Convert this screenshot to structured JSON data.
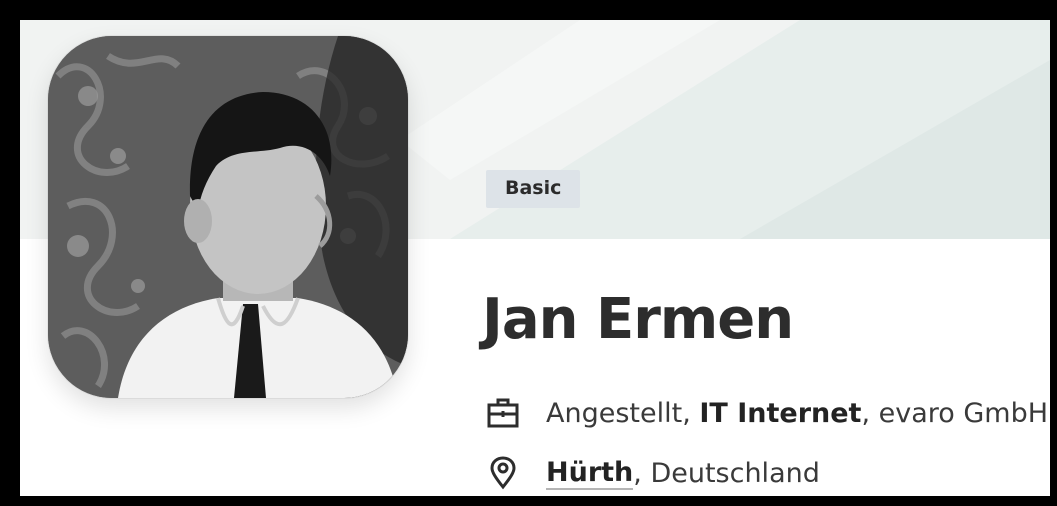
{
  "profile": {
    "badge": "Basic",
    "name": "Jan Ermen",
    "job": {
      "status": "Angestellt",
      "sep1": ", ",
      "industry": "IT Internet",
      "sep2": ", ",
      "company": "evaro GmbH"
    },
    "location": {
      "city": "Hürth",
      "sep": ", ",
      "country": "Deutschland"
    }
  },
  "icons": {
    "job": "briefcase-icon",
    "location": "location-pin-icon"
  },
  "colors": {
    "banner": "#f1f3f2",
    "badge_bg": "#dde3e8",
    "text": "#2d2d2d"
  }
}
